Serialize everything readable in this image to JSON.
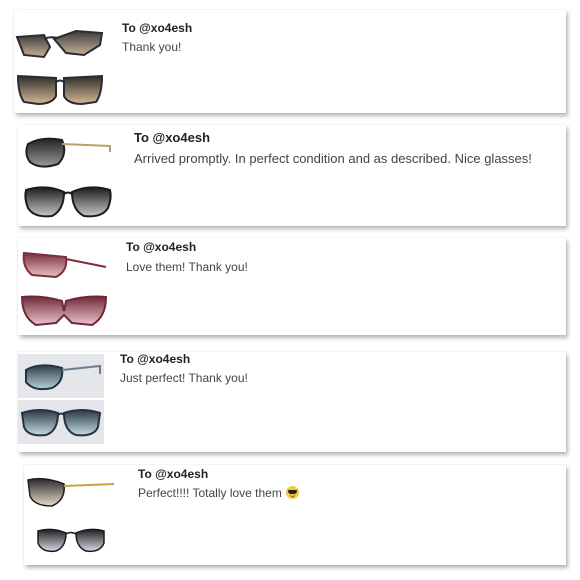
{
  "reviews": [
    {
      "recipient": "To @xo4esh",
      "message": "Thank you!",
      "images": [
        "sunglasses-tortoise-side",
        "sunglasses-tortoise-front"
      ]
    },
    {
      "recipient": "To @xo4esh",
      "message": "Arrived promptly. In perfect condition and as described. Nice glasses!",
      "images": [
        "sunglasses-black-oversized-side",
        "sunglasses-black-oversized-front"
      ]
    },
    {
      "recipient": "To @xo4esh",
      "message": "Love them! Thank you!",
      "images": [
        "sunglasses-burgundy-side",
        "sunglasses-burgundy-front"
      ]
    },
    {
      "recipient": "To @xo4esh",
      "message": "Just perfect! Thank you!",
      "images": [
        "sunglasses-navy-side",
        "sunglasses-navy-front"
      ]
    },
    {
      "recipient": "To @xo4esh",
      "message": "Perfect!!!! Totally love them",
      "images": [
        "sunglasses-gold-butterfly-side",
        "sunglasses-gold-butterfly-front"
      ],
      "emoji": "smiling-face-with-sunglasses-icon"
    }
  ],
  "colors": {
    "card_background": "#ffffff",
    "text_primary": "#222222",
    "text_secondary": "#444444"
  }
}
